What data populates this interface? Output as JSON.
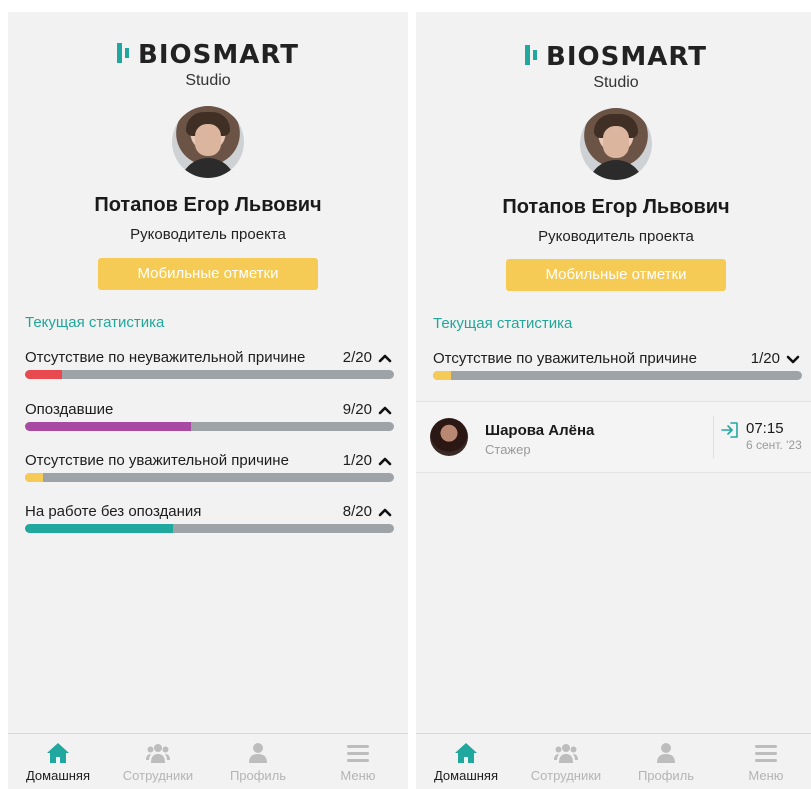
{
  "brand": {
    "logo_text": "BIOSMART",
    "subtitle": "Studio"
  },
  "profile": {
    "name": "Потапов Егор Львович",
    "role": "Руководитель проекта",
    "mobile_button": "Мобильные отметки"
  },
  "section_title": "Текущая статистика",
  "left_screen": {
    "stats": [
      {
        "label": "Отсутствие по неуважительной причине",
        "count": "2/20",
        "fraction": 0.1,
        "color": "#e94a4f",
        "expanded": true
      },
      {
        "label": "Опоздавшие",
        "count": "9/20",
        "fraction": 0.45,
        "color": "#a84aa3",
        "expanded": true
      },
      {
        "label": "Отсутствие по уважительной причине",
        "count": "1/20",
        "fraction": 0.05,
        "color": "#f6cb55",
        "expanded": true
      },
      {
        "label": "На работе без опоздания",
        "count": "8/20",
        "fraction": 0.4,
        "color": "#20a89e",
        "expanded": true
      }
    ]
  },
  "right_screen": {
    "profile_name": "Потапов Егор  Львович",
    "stat": {
      "label": "Отсутствие по уважительной причине",
      "count": "1/20",
      "fraction": 0.05,
      "color": "#f6cb55",
      "expanded": false
    },
    "employee": {
      "name": "Шарова Алёна",
      "role": "Стажер",
      "time": "07:15",
      "date": "6 сент. '23"
    }
  },
  "tabbar": {
    "items": [
      {
        "label": "Домашняя",
        "icon": "home-icon",
        "active": true
      },
      {
        "label": "Сотрудники",
        "icon": "employees-icon",
        "active": false
      },
      {
        "label": "Профиль",
        "icon": "profile-icon",
        "active": false
      },
      {
        "label": "Меню",
        "icon": "menu-icon",
        "active": false
      }
    ]
  },
  "colors": {
    "accent": "#20a89e",
    "button": "#f6cb55",
    "track": "#9ea3a8",
    "background": "#f2f2f2"
  }
}
